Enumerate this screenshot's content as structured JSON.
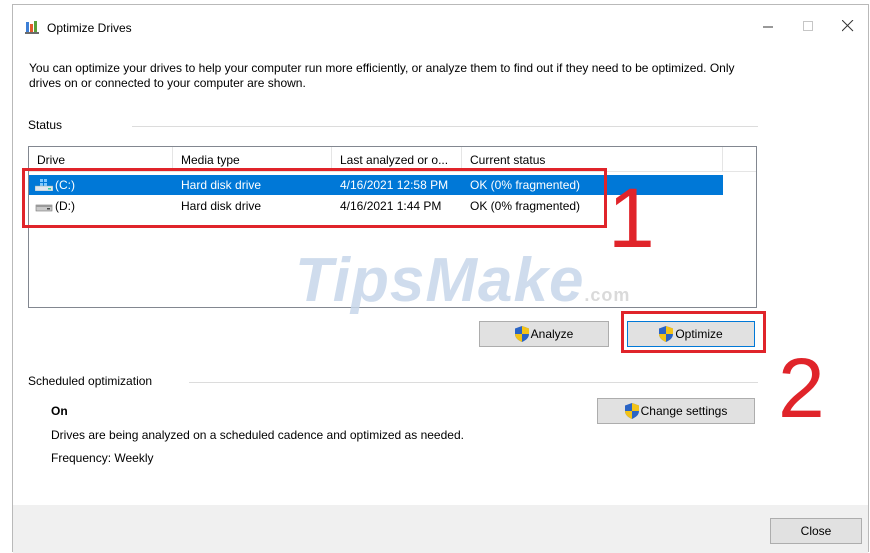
{
  "window": {
    "title": "Optimize Drives",
    "description": "You can optimize your drives to help your computer run more efficiently, or analyze them to find out if they need to be optimized. Only drives on or connected to your computer are shown."
  },
  "status": {
    "label": "Status",
    "columns": [
      "Drive",
      "Media type",
      "Last analyzed or o...",
      "Current status"
    ],
    "rows": [
      {
        "drive": "(C:)",
        "media": "Hard disk drive",
        "last": "4/16/2021 12:58 PM",
        "status": "OK (0% fragmented)",
        "selected": true,
        "icon": "system-drive-icon"
      },
      {
        "drive": "(D:)",
        "media": "Hard disk drive",
        "last": "4/16/2021 1:44 PM",
        "status": "OK (0% fragmented)",
        "selected": false,
        "icon": "hard-drive-icon"
      }
    ]
  },
  "buttons": {
    "analyze": "Analyze",
    "optimize": "Optimize",
    "change_settings": "Change settings",
    "close": "Close"
  },
  "scheduled": {
    "label": "Scheduled optimization",
    "state": "On",
    "details": "Drives are being analyzed on a scheduled cadence and optimized as needed.",
    "frequency": "Frequency: Weekly"
  },
  "annotations": {
    "num1": "1",
    "num2": "2",
    "color": "#e0242a"
  },
  "watermark": {
    "brand": "TipsMake",
    "suffix": ".com"
  },
  "colors": {
    "selection": "#0078d7"
  }
}
